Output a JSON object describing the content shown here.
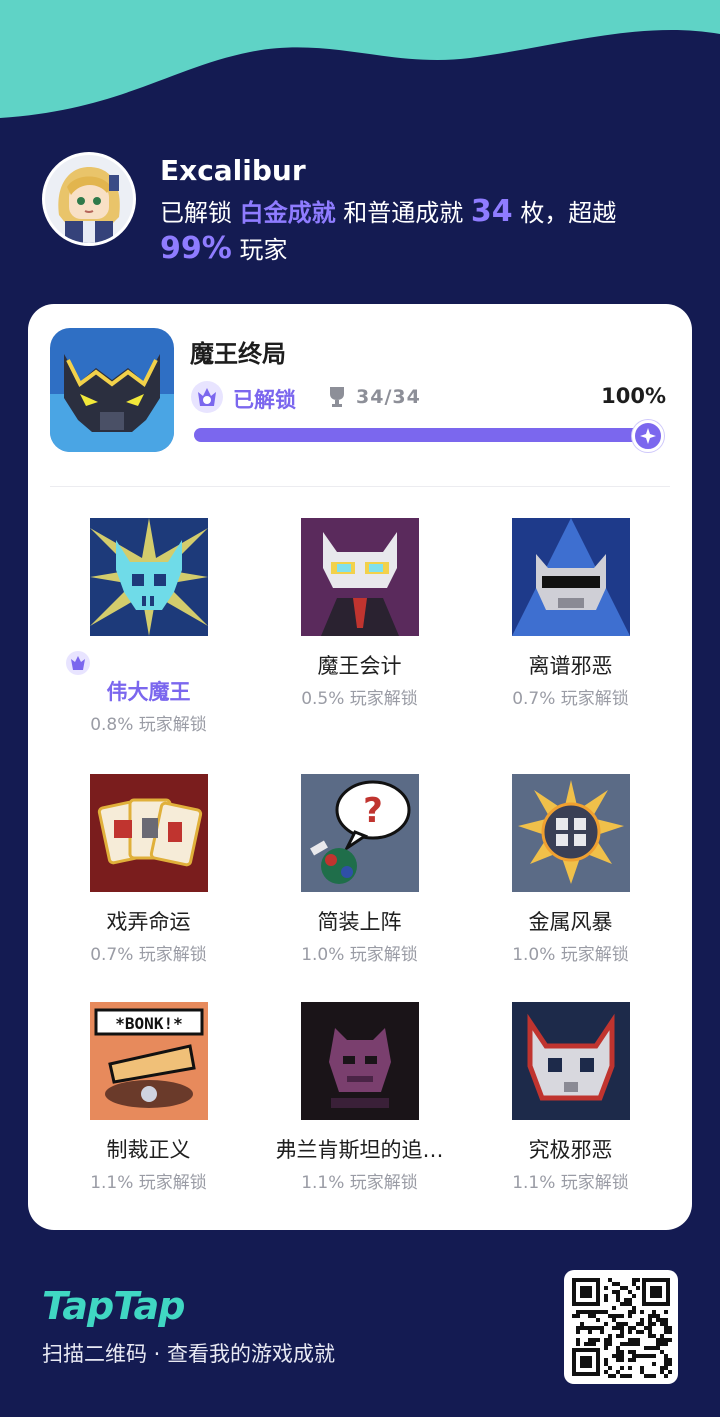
{
  "colors": {
    "background": "#141b52",
    "teal": "#5fd3c6",
    "accent": "#7b67ee",
    "highlight": "#8f7cff"
  },
  "profile": {
    "username": "Excalibur",
    "line_part1": "已解锁",
    "platinum_label": "白金成就",
    "line_part2": "和普通成就",
    "count": "34",
    "line_part3": "枚，超越",
    "percentile": "99%",
    "line_part4": "玩家"
  },
  "game": {
    "title": "魔王终局",
    "unlocked_label": "已解锁",
    "count_text": "34/34",
    "percent_text": "100%",
    "progress": 1.0
  },
  "achievements": [
    {
      "name": "伟大魔王",
      "rate": "0.8% 玩家解锁",
      "icon": "horned-skull-burst-icon",
      "featured": true
    },
    {
      "name": "魔王会计",
      "rate": "0.5% 玩家解锁",
      "icon": "skull-glasses-suit-icon",
      "featured": false
    },
    {
      "name": "离谱邪恶",
      "rate": "0.7% 玩家解锁",
      "icon": "skull-sunglasses-icon",
      "featured": false
    },
    {
      "name": "戏弄命运",
      "rate": "0.7% 玩家解锁",
      "icon": "playing-cards-icon",
      "featured": false
    },
    {
      "name": "简装上阵",
      "rate": "1.0% 玩家解锁",
      "icon": "question-bubble-icon",
      "featured": false
    },
    {
      "name": "金属风暴",
      "rate": "1.0% 玩家解锁",
      "icon": "spiked-target-icon",
      "featured": false
    },
    {
      "name": "制裁正义",
      "rate": "1.1% 玩家解锁",
      "icon": "bonk-hammer-icon",
      "featured": false,
      "art_text": "*BONK!*"
    },
    {
      "name": "弗兰肯斯坦的追…",
      "rate": "1.1% 玩家解锁",
      "icon": "purple-demon-icon",
      "featured": false
    },
    {
      "name": "究极邪恶",
      "rate": "1.1% 玩家解锁",
      "icon": "red-outline-skull-icon",
      "featured": false
    }
  ],
  "footer": {
    "brand": "TapTap",
    "caption": "扫描二维码 · 查看我的游戏成就",
    "qr_icon": "qr-code-icon"
  }
}
